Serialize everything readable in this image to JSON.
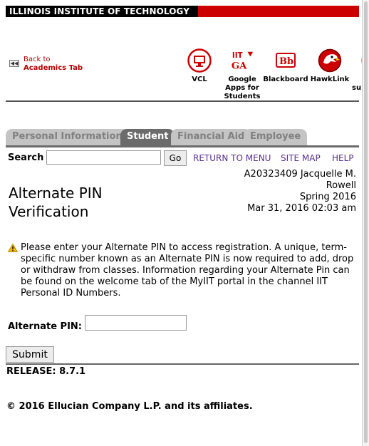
{
  "header": {
    "institution": "ILLINOIS INSTITUTE OF TECHNOLOGY"
  },
  "back_link": {
    "line1": "Back to",
    "line2": "Academics Tab"
  },
  "tools": [
    {
      "label": "VCL",
      "icon": "monitor-icon"
    },
    {
      "label": "Google Apps for Students",
      "icon": "iit-gapps-icon"
    },
    {
      "label": "Blackboard",
      "icon": "blackboard-icon"
    },
    {
      "label": "HawkLink",
      "icon": "hawk-icon"
    },
    {
      "label": "su",
      "icon": "partial-icon"
    }
  ],
  "tabs": [
    {
      "label": "Personal Information",
      "active": false
    },
    {
      "label": "Student",
      "active": true
    },
    {
      "label": "Financial Aid",
      "active": false
    },
    {
      "label": "Employee",
      "active": false
    }
  ],
  "search": {
    "label": "Search",
    "value": "",
    "go_label": "Go"
  },
  "nav_links": {
    "return_menu": "RETURN TO MENU",
    "site_map": "SITE MAP",
    "help": "HELP"
  },
  "user": {
    "id_name": "A20323409 Jacquelle M. Rowell",
    "term": "Spring 2016",
    "datetime": "Mar 31, 2016 02:03 am"
  },
  "page_title": "Alternate PIN Verification",
  "message": "Please enter your Alternate PIN to access registration. A unique, term-specific number known as an Alternate PIN is now required to add, drop or withdraw from classes. Information regarding your Alternate Pin can be found on the welcome tab of the MyIIT portal in the channel IIT Personal ID Numbers.",
  "form": {
    "pin_label": "Alternate PIN:",
    "pin_value": "",
    "submit_label": "Submit"
  },
  "footer": {
    "release": "RELEASE: 8.7.1",
    "copyright": "© 2016 Ellucian Company L.P. and its affiliates."
  },
  "colors": {
    "brand_red": "#cc0000",
    "tab_active": "#6b6b6b",
    "tab_inactive": "#c4c4c4",
    "link_purple": "#5a2f93",
    "back_link_red": "#b60000"
  }
}
